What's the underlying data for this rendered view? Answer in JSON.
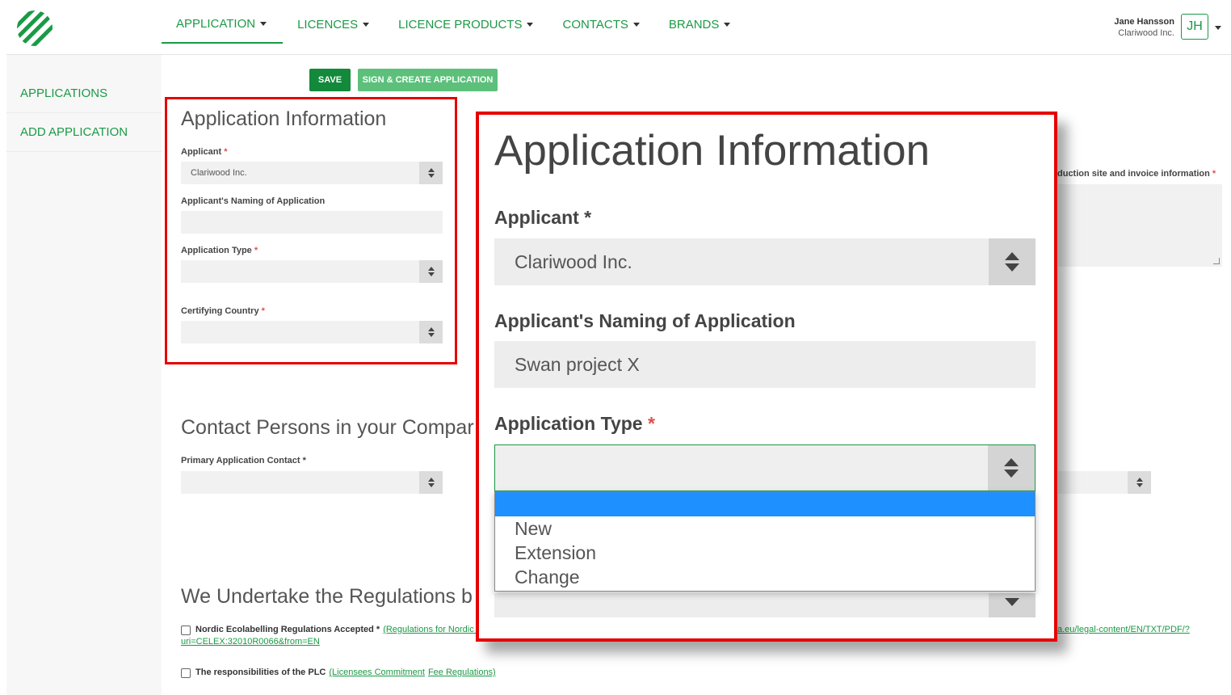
{
  "nav": {
    "items": [
      "APPLICATION",
      "LICENCES",
      "LICENCE PRODUCTS",
      "CONTACTS",
      "BRANDS"
    ],
    "user_name": "Jane Hansson",
    "user_org": "Clariwood Inc.",
    "avatar_initials": "JH"
  },
  "sidebar": {
    "items": [
      "APPLICATIONS",
      "ADD APPLICATION"
    ]
  },
  "toolbar": {
    "save_label": "SAVE",
    "sign_label": "SIGN & CREATE APPLICATION"
  },
  "form": {
    "section_title": "Application Information",
    "applicant_label": "Applicant",
    "applicant_value": "Clariwood Inc.",
    "naming_label": "Applicant's Naming of Application",
    "naming_value": "",
    "type_label": "Application Type",
    "type_value": "",
    "country_label": "Certifying Country",
    "country_value": "",
    "required_marker": "*",
    "contacts_title": "Contact Persons in your Compar",
    "primary_contact_label": "Primary Application Contact",
    "regulations_title": "We Undertake the Regulations b",
    "right_label": "duction site and invoice information",
    "reg_checkbox_label": "Nordic Ecolabelling Regulations Accepted",
    "reg_link": "(Regulations for Nordic E",
    "reg_url_line": "uri=CELEX:32010R0066&from=EN",
    "reg_url_right": "a.eu/legal-content/EN/TXT/PDF/?",
    "plc_label": "The responsibilities of the PLC",
    "plc_link_1": "(Licensees Commitment",
    "plc_link_2": "Fee Regulations)"
  },
  "zoom": {
    "title": "Application Information",
    "applicant_label": "Applicant",
    "applicant_value": "Clariwood Inc.",
    "naming_label": "Applicant's Naming of Application",
    "naming_value": "Swan project X",
    "type_label": "Application Type",
    "type_options": [
      "",
      "New",
      "Extension",
      "Change"
    ]
  },
  "colors": {
    "brand_green": "#1a9a45",
    "highlight_blue": "#1e90ff",
    "annotation_red": "#e60000"
  }
}
